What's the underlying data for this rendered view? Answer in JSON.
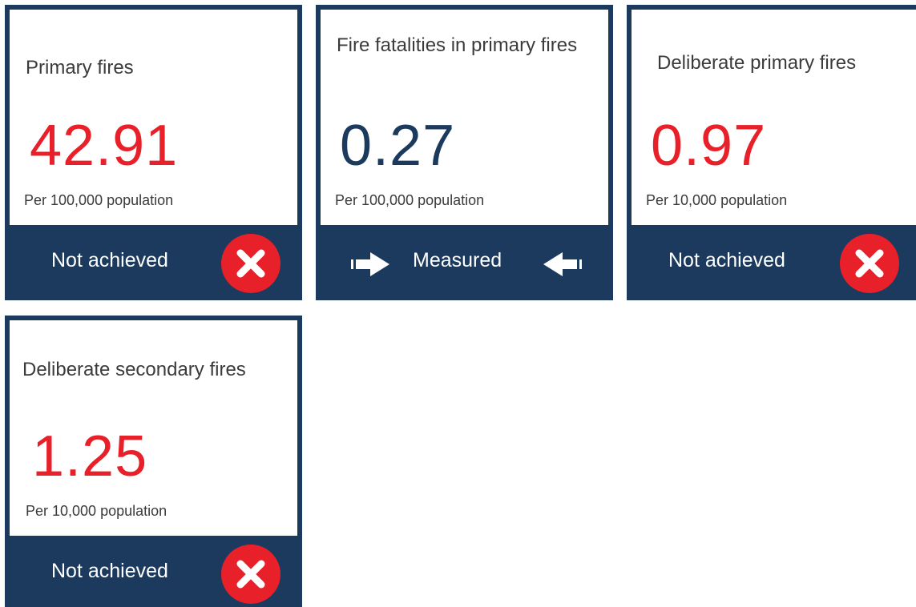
{
  "colors": {
    "navy": "#1b3a5e",
    "red": "#e8202a",
    "text_grey": "#3b3b3b",
    "white": "#ffffff"
  },
  "cards": [
    {
      "title": "Primary fires",
      "value": "42.91",
      "unit": "Per 100,000 population",
      "status": "Not achieved",
      "status_icon": "cross-icon"
    },
    {
      "title": "Fire fatalities in primary fires",
      "value": "0.27",
      "unit": "Per 100,000 population",
      "status": "Measured",
      "status_icon": "arrow-icons"
    },
    {
      "title": "Deliberate primary fires",
      "value": "0.97",
      "unit": "Per 10,000 population",
      "status": "Not achieved",
      "status_icon": "cross-icon"
    },
    {
      "title": "Deliberate secondary fires",
      "value": "1.25",
      "unit": "Per 10,000 population",
      "status": "Not achieved",
      "status_icon": "cross-icon"
    }
  ]
}
